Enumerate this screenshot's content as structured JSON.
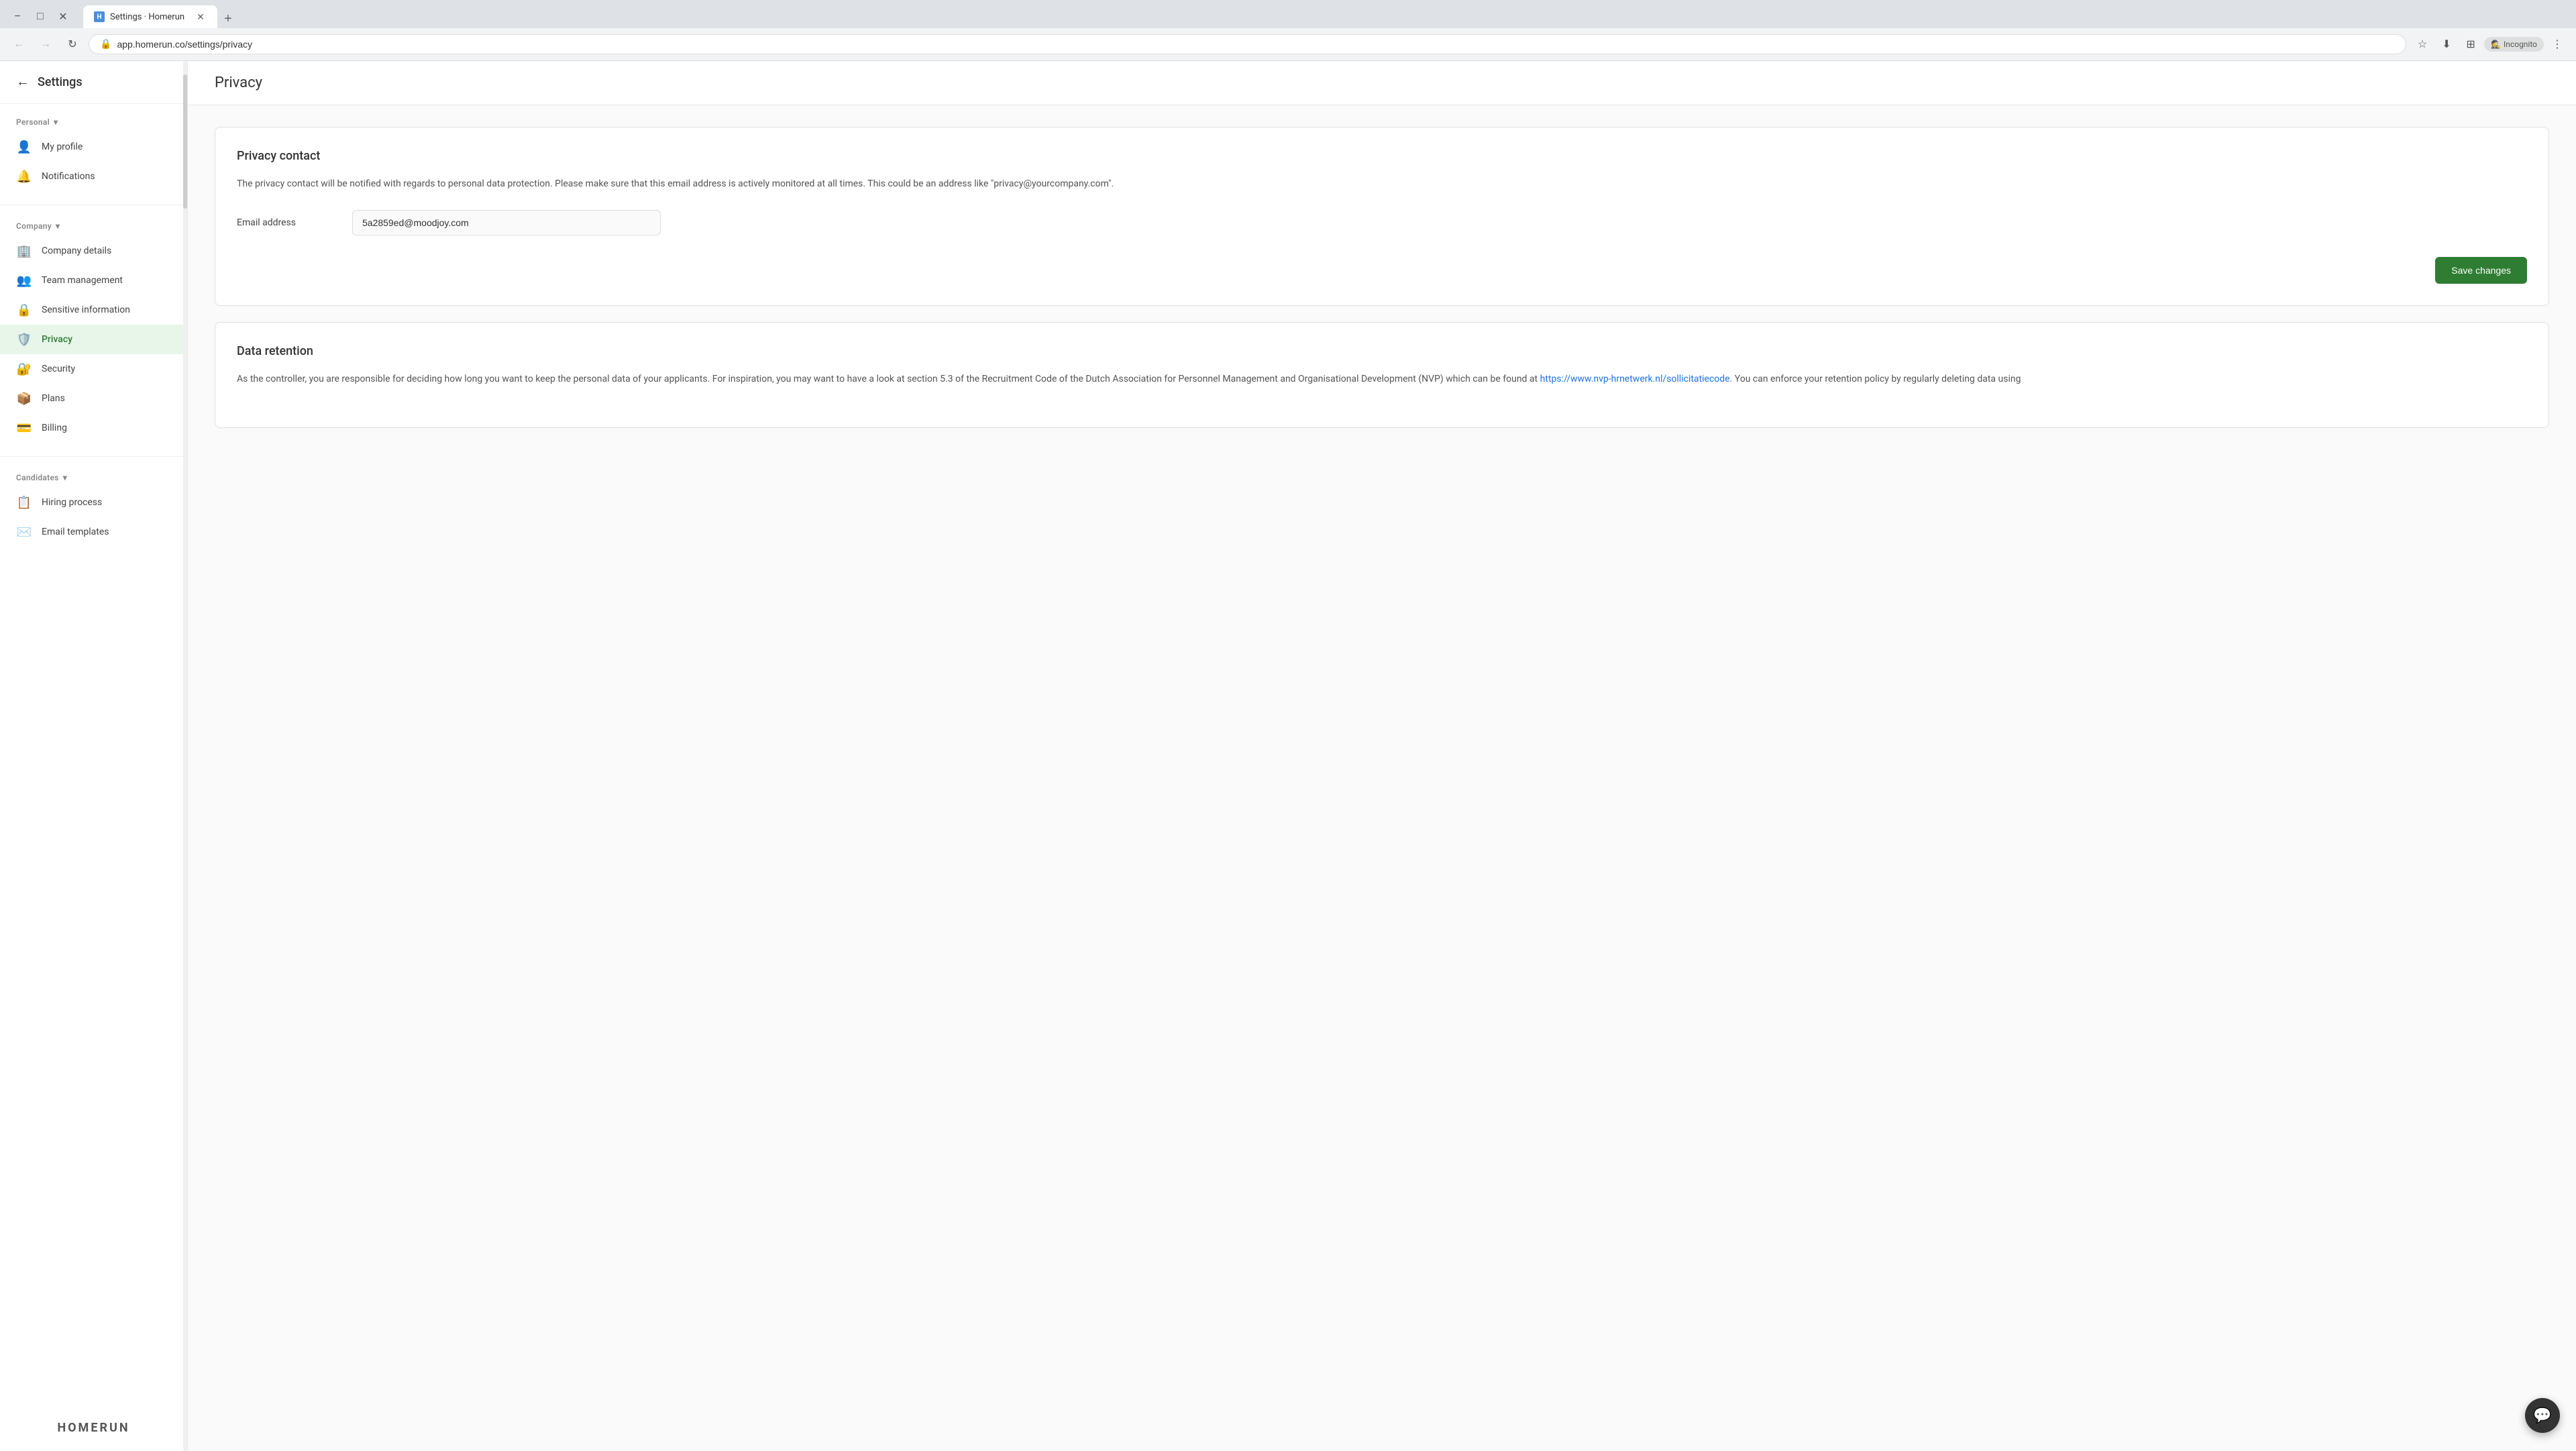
{
  "browser": {
    "url": "app.homerun.co/settings/privacy",
    "tab_title": "Settings · Homerun",
    "tab_favicon": "H",
    "incognito_label": "Incognito"
  },
  "sidebar": {
    "back_label": "Settings",
    "personal_label": "Personal",
    "company_label": "Company",
    "candidates_label": "Candidates",
    "items_personal": [
      {
        "id": "my-profile",
        "label": "My profile",
        "icon": "👤"
      },
      {
        "id": "notifications",
        "label": "Notifications",
        "icon": "🔔"
      }
    ],
    "items_company": [
      {
        "id": "company-details",
        "label": "Company details",
        "icon": "🏢"
      },
      {
        "id": "team-management",
        "label": "Team management",
        "icon": "👥"
      },
      {
        "id": "sensitive-information",
        "label": "Sensitive information",
        "icon": "🔒"
      },
      {
        "id": "privacy",
        "label": "Privacy",
        "icon": "🛡️"
      },
      {
        "id": "security",
        "label": "Security",
        "icon": "🔐"
      },
      {
        "id": "plans",
        "label": "Plans",
        "icon": "📦"
      },
      {
        "id": "billing",
        "label": "Billing",
        "icon": "💳"
      }
    ],
    "items_candidates": [
      {
        "id": "hiring-process",
        "label": "Hiring process",
        "icon": "📋"
      },
      {
        "id": "email-templates",
        "label": "Email templates",
        "icon": "✉️"
      }
    ],
    "logo": "HOMERUN"
  },
  "page": {
    "title": "Privacy",
    "privacy_contact": {
      "section_title": "Privacy contact",
      "description": "The privacy contact will be notified with regards to personal data protection. Please make sure that this email address is actively monitored at all times. This could be an address like \"privacy@yourcompany.com\".",
      "email_label": "Email address",
      "email_value": "5a2859ed@moodjoy.com",
      "save_button": "Save changes"
    },
    "data_retention": {
      "section_title": "Data retention",
      "description": "As the controller, you are responsible for deciding how long you want to keep the personal data of your applicants. For inspiration, you may want to have a look at section 5.3 of the Recruitment Code of the Dutch Association for Personnel Management and Organisational Development (NVP) which can be found at https://www.nvp-hrnetwerk.nl/sollicitatiecode. You can enforce your retention policy by regularly deleting data using"
    }
  },
  "chat_widget": {
    "icon": "💬"
  }
}
